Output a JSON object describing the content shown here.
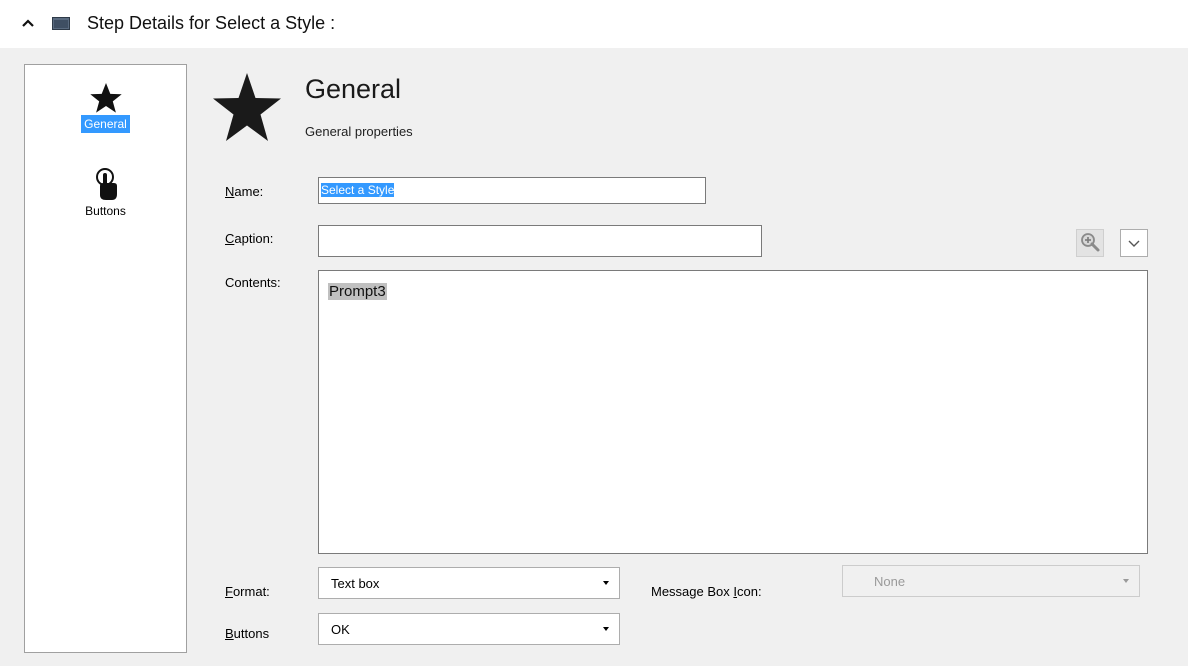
{
  "header": {
    "title": "Step Details for Select a Style :",
    "collapse_icon": "chevron-up-icon",
    "window_icon": "window-icon"
  },
  "nav": {
    "items": [
      {
        "label": "General",
        "icon": "star-icon",
        "selected": true
      },
      {
        "label": "Buttons",
        "icon": "pointer-hand-icon",
        "selected": false
      }
    ]
  },
  "section": {
    "title": "General",
    "subtitle": "General properties",
    "icon": "star-icon"
  },
  "form": {
    "name_label_u": "N",
    "name_label_rest": "ame:",
    "name_value": "Select a Style",
    "caption_label_u": "C",
    "caption_label_rest": "aption:",
    "caption_value": "",
    "contents_label": "Contents:",
    "contents_value": "Prompt3",
    "format_label_u": "F",
    "format_label_rest": "ormat:",
    "format_value": "Text box",
    "buttons_label_u": "B",
    "buttons_label_rest": "uttons",
    "buttons_value": "OK",
    "msgbox_icon_label_pre": "Message Box ",
    "msgbox_icon_label_u": "I",
    "msgbox_icon_label_post": "con:",
    "msgbox_icon_value": "None"
  },
  "colors": {
    "selection": "#3399ff",
    "panel_bg": "#f0f0f0",
    "token_bg": "#c0c0c0"
  }
}
